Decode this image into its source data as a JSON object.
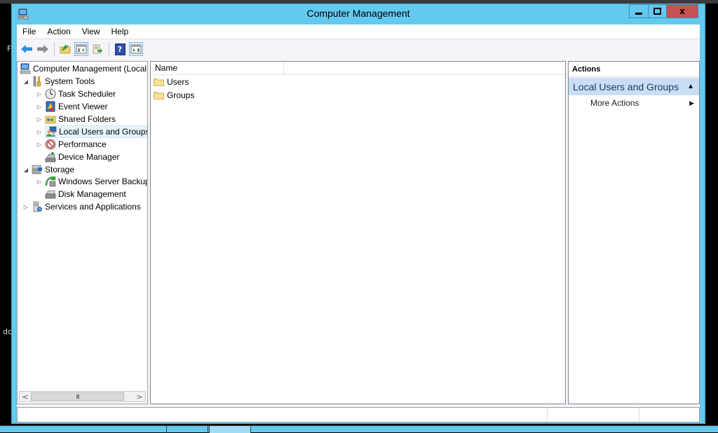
{
  "background": {
    "left_fragments": [
      "F",
      "dc"
    ]
  },
  "window": {
    "title": "Computer Management",
    "icon": "computer-management-icon",
    "controls": {
      "minimize": "minimize-icon",
      "maximize": "maximize-icon",
      "close": "close-icon",
      "close_glyph": "x"
    },
    "accent_color": "#63c9ef",
    "close_color": "#c75050"
  },
  "menubar": {
    "items": [
      "File",
      "Action",
      "View",
      "Help"
    ]
  },
  "toolbar": {
    "buttons": [
      {
        "name": "back",
        "icon": "back-arrow-icon"
      },
      {
        "name": "forward",
        "icon": "forward-arrow-icon"
      },
      {
        "name": "up-one-level",
        "icon": "up-folder-icon"
      },
      {
        "name": "show-hide-console-tree",
        "icon": "console-tree-icon"
      },
      {
        "name": "export-list",
        "icon": "export-list-icon"
      },
      {
        "name": "help",
        "icon": "help-icon",
        "glyph": "?"
      },
      {
        "name": "show-hide-action-pane",
        "icon": "action-pane-icon"
      }
    ]
  },
  "tree": {
    "items": [
      {
        "label": "Computer Management (Local",
        "level": 0,
        "expander": "",
        "icon": "computer-management-icon"
      },
      {
        "label": "System Tools",
        "level": 1,
        "expander": "expanded",
        "icon": "tools-icon"
      },
      {
        "label": "Task Scheduler",
        "level": 2,
        "expander": "collapsed",
        "icon": "clock-icon"
      },
      {
        "label": "Event Viewer",
        "level": 2,
        "expander": "collapsed",
        "icon": "event-viewer-icon"
      },
      {
        "label": "Shared Folders",
        "level": 2,
        "expander": "collapsed",
        "icon": "shared-folders-icon"
      },
      {
        "label": "Local Users and Groups",
        "level": 2,
        "expander": "collapsed",
        "icon": "users-icon",
        "selected": true
      },
      {
        "label": "Performance",
        "level": 2,
        "expander": "collapsed",
        "icon": "performance-icon"
      },
      {
        "label": "Device Manager",
        "level": 2,
        "expander": "",
        "icon": "device-manager-icon"
      },
      {
        "label": "Storage",
        "level": 1,
        "expander": "expanded",
        "icon": "storage-icon"
      },
      {
        "label": "Windows Server Backup",
        "level": 2,
        "expander": "collapsed",
        "icon": "backup-icon"
      },
      {
        "label": "Disk Management",
        "level": 2,
        "expander": "",
        "icon": "disk-icon"
      },
      {
        "label": "Services and Applications",
        "level": 1,
        "expander": "collapsed",
        "icon": "services-icon"
      }
    ],
    "scrollbar": {
      "left": "<",
      "right": ">",
      "grip": "III"
    }
  },
  "list": {
    "columns": [
      "Name"
    ],
    "rows": [
      {
        "name": "Users",
        "icon": "folder-icon"
      },
      {
        "name": "Groups",
        "icon": "folder-icon"
      }
    ]
  },
  "actions": {
    "header": "Actions",
    "group_title": "Local Users and Groups",
    "group_collapse_glyph": "▲",
    "items": [
      {
        "label": "More Actions",
        "submenu_glyph": "▶"
      }
    ]
  },
  "glyphs": {
    "expanded": "◢",
    "collapsed": "▷"
  }
}
